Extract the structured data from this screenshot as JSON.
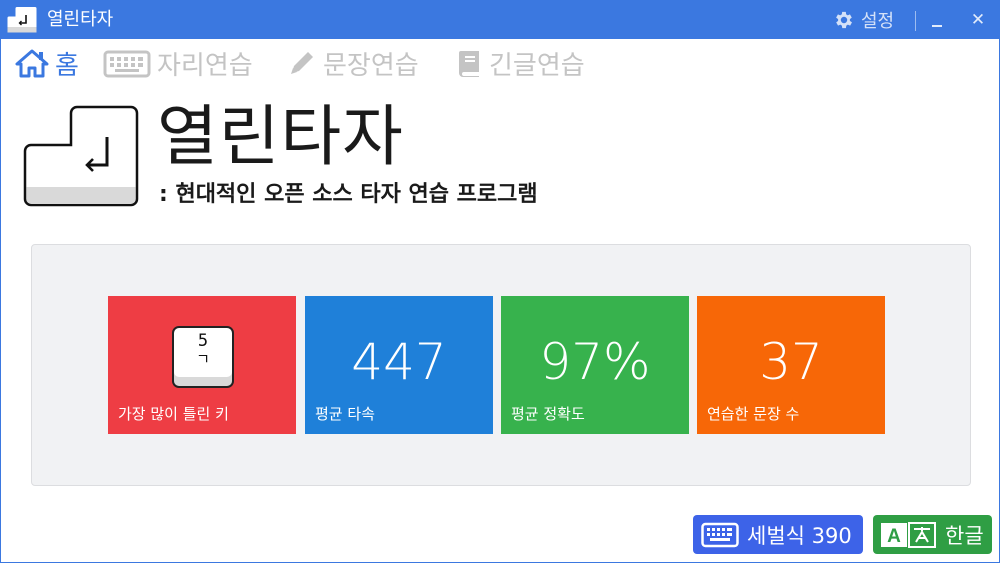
{
  "window": {
    "title": "열린타자",
    "settings_label": "설정",
    "close_glyph": "✕",
    "accent_color": "#3b78e0"
  },
  "nav": {
    "items": [
      {
        "label": "홈",
        "icon": "home-icon",
        "active": true
      },
      {
        "label": "자리연습",
        "icon": "keyboard-icon",
        "active": false
      },
      {
        "label": "문장연습",
        "icon": "pencil-icon",
        "active": false
      },
      {
        "label": "긴글연습",
        "icon": "book-icon",
        "active": false
      }
    ]
  },
  "header": {
    "title": "열린타자",
    "subtitle": ": 현대적인 오픈 소스 타자 연습 프로그램"
  },
  "stats": [
    {
      "label": "가장 많이 틀린 키",
      "key_top": "5",
      "key_bottom": "ㄱ",
      "color": "#ee3d44"
    },
    {
      "label": "평균 타속",
      "value": "447",
      "color": "#1f80d9"
    },
    {
      "label": "평균 정확도",
      "value": "97%",
      "color": "#37b24d"
    },
    {
      "label": "연습한 문장 수",
      "value": "37",
      "color": "#f76707"
    }
  ],
  "footer": {
    "keyboard_layout": "세벌식 390",
    "language": "한글",
    "language_icon_text": "A"
  }
}
